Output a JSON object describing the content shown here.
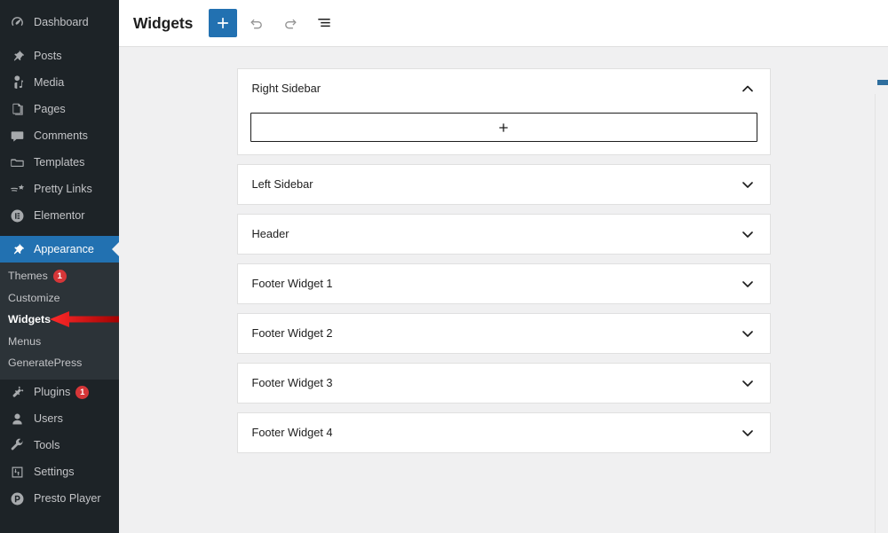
{
  "sidebar": {
    "items": [
      {
        "label": "Dashboard",
        "icon": "dashboard-icon",
        "badge": null,
        "active": false,
        "separator_after": true
      },
      {
        "label": "Posts",
        "icon": "pin-icon",
        "badge": null,
        "active": false,
        "separator_after": false
      },
      {
        "label": "Media",
        "icon": "media-icon",
        "badge": null,
        "active": false,
        "separator_after": false
      },
      {
        "label": "Pages",
        "icon": "pages-icon",
        "badge": null,
        "active": false,
        "separator_after": false
      },
      {
        "label": "Comments",
        "icon": "comment-icon",
        "badge": null,
        "active": false,
        "separator_after": false
      },
      {
        "label": "Templates",
        "icon": "folder-icon",
        "badge": null,
        "active": false,
        "separator_after": false
      },
      {
        "label": "Pretty Links",
        "icon": "shooting-star-icon",
        "badge": null,
        "active": false,
        "separator_after": false
      },
      {
        "label": "Elementor",
        "icon": "elementor-icon",
        "badge": null,
        "active": false,
        "separator_after": true
      },
      {
        "label": "Appearance",
        "icon": "appearance-brush-icon",
        "badge": null,
        "active": true,
        "separator_after": false
      }
    ],
    "submenu": [
      {
        "label": "Themes",
        "badge": "1",
        "current": false
      },
      {
        "label": "Customize",
        "badge": null,
        "current": false
      },
      {
        "label": "Widgets",
        "badge": null,
        "current": true
      },
      {
        "label": "Menus",
        "badge": null,
        "current": false
      },
      {
        "label": "GeneratePress",
        "badge": null,
        "current": false
      }
    ],
    "items_bottom": [
      {
        "label": "Plugins",
        "icon": "plugin-icon",
        "badge": "1",
        "active": false,
        "separator_after": false
      },
      {
        "label": "Users",
        "icon": "user-icon",
        "badge": null,
        "active": false,
        "separator_after": false
      },
      {
        "label": "Tools",
        "icon": "wrench-icon",
        "badge": null,
        "active": false,
        "separator_after": false
      },
      {
        "label": "Settings",
        "icon": "settings-sliders-icon",
        "badge": null,
        "active": false,
        "separator_after": false
      },
      {
        "label": "Presto Player",
        "icon": "presto-player-icon",
        "badge": null,
        "active": false,
        "separator_after": false
      }
    ],
    "active_color": "#2271b1",
    "background_color": "#1d2327",
    "submenu_background_color": "#2c3338",
    "badge_color": "#d63638"
  },
  "annotation": {
    "arrow_color": "#e01b1b",
    "points_to": "Widgets"
  },
  "header": {
    "title": "Widgets",
    "add_block_label": "+",
    "buttons": [
      {
        "name": "add-block-button",
        "icon": "plus-icon",
        "primary": true,
        "disabled": false
      },
      {
        "name": "undo-button",
        "icon": "undo-icon",
        "primary": false,
        "disabled": true
      },
      {
        "name": "redo-button",
        "icon": "redo-icon",
        "primary": false,
        "disabled": true
      },
      {
        "name": "list-view-button",
        "icon": "list-view-icon",
        "primary": false,
        "disabled": false
      }
    ]
  },
  "widget_areas": [
    {
      "title": "Right Sidebar",
      "expanded": true,
      "chevron": "chevron-up-icon",
      "appender": "+"
    },
    {
      "title": "Left Sidebar",
      "expanded": false,
      "chevron": "chevron-down-icon",
      "appender": null
    },
    {
      "title": "Header",
      "expanded": false,
      "chevron": "chevron-down-icon",
      "appender": null
    },
    {
      "title": "Footer Widget 1",
      "expanded": false,
      "chevron": "chevron-down-icon",
      "appender": null
    },
    {
      "title": "Footer Widget 2",
      "expanded": false,
      "chevron": "chevron-down-icon",
      "appender": null
    },
    {
      "title": "Footer Widget 3",
      "expanded": false,
      "chevron": "chevron-down-icon",
      "appender": null
    },
    {
      "title": "Footer Widget 4",
      "expanded": false,
      "chevron": "chevron-down-icon",
      "appender": null
    }
  ]
}
